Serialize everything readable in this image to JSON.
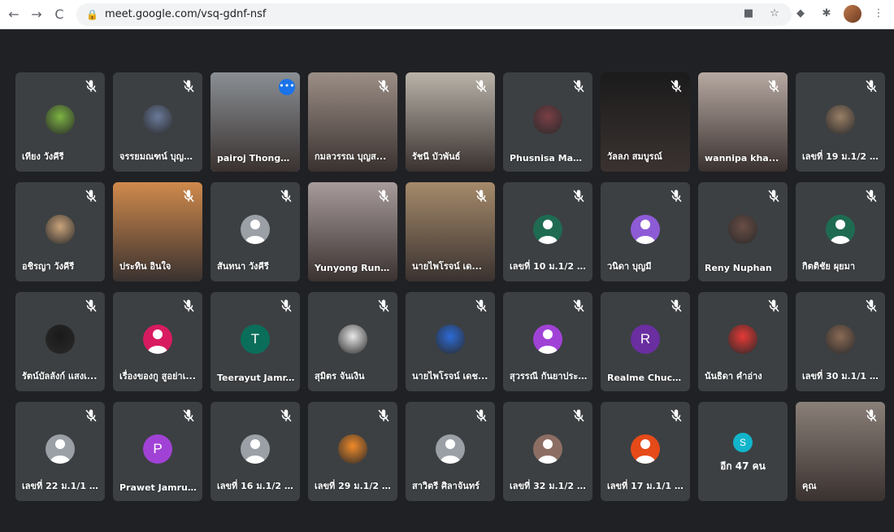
{
  "browser": {
    "url": "meet.google.com/vsq-gdnf-nsf",
    "back_glyph": "←",
    "forward_glyph": "→",
    "reload_glyph": "C",
    "lock_glyph": "🔒",
    "star_glyph": "☆",
    "menu_glyph": "⋮"
  },
  "more_people": {
    "initial": "S",
    "label": "อีก 47 คน"
  },
  "tiles": [
    {
      "name": "เทียง วังคีรี",
      "kind": "avatar",
      "color": "#7cb342",
      "initial": ""
    },
    {
      "name": "จรรยมณฑน์ บุญสิ...",
      "kind": "photo",
      "color": "#6a7a9a",
      "initial": ""
    },
    {
      "name": "pairoj Thongp...",
      "kind": "video",
      "color": "#8a8f94",
      "initial": "",
      "active": true
    },
    {
      "name": "กมลวรรณ บุญส...",
      "kind": "video",
      "color": "#9c8e86",
      "initial": ""
    },
    {
      "name": "รัชนี บัวพันธ์",
      "kind": "video",
      "color": "#b9b3a9",
      "initial": ""
    },
    {
      "name": "Phusnisa Makk...",
      "kind": "photo",
      "color": "#7a3f46",
      "initial": ""
    },
    {
      "name": "วัลลภ สมบูรณ์",
      "kind": "video",
      "color": "#1b1b1b",
      "initial": ""
    },
    {
      "name": "wannipa kha...",
      "kind": "video",
      "color": "#b7a9a2",
      "initial": ""
    },
    {
      "name": "เลขที่ 19 ม.1/2 เด็...",
      "kind": "photo",
      "color": "#9a7f66",
      "initial": ""
    },
    {
      "name": "อชิรญา วังคีรี",
      "kind": "photo",
      "color": "#caa37b",
      "initial": ""
    },
    {
      "name": "ประทิน อินใจ",
      "kind": "video",
      "color": "#d08a4c",
      "initial": ""
    },
    {
      "name": "สันทนา วังคีรี",
      "kind": "person",
      "color": "#9aa0a6",
      "initial": ""
    },
    {
      "name": "Yunyong Rung...",
      "kind": "video",
      "color": "#a79b9b",
      "initial": ""
    },
    {
      "name": "นายไพโรจน์ เด...",
      "kind": "video",
      "color": "#a58a6a",
      "initial": ""
    },
    {
      "name": "เลขที่ 10 ม.1/2 เด็...",
      "kind": "person",
      "color": "#1e6b52",
      "initial": ""
    },
    {
      "name": "วนิดา บุญมี",
      "kind": "person",
      "color": "#8e5bd6",
      "initial": ""
    },
    {
      "name": "Reny Nuphan",
      "kind": "photo",
      "color": "#6a4d45",
      "initial": ""
    },
    {
      "name": "กิตติชัย ผุยมา",
      "kind": "person",
      "color": "#1e6b52",
      "initial": ""
    },
    {
      "name": "รัตน์บัลลังก์ แสงเ...",
      "kind": "photo",
      "color": "#1a1a1a",
      "initial": ""
    },
    {
      "name": "เรื่องของกู สูอย่าเ...",
      "kind": "person",
      "color": "#d81b60",
      "initial": ""
    },
    {
      "name": "Teerayut Jamr...",
      "kind": "letter",
      "color": "#0b6e5a",
      "initial": "T"
    },
    {
      "name": "สุมิตร จันเงิน",
      "kind": "photo",
      "color": "#e8e8e8",
      "initial": ""
    },
    {
      "name": "นายไพโรจน์ เดช...",
      "kind": "photo",
      "color": "#2d6bd6",
      "initial": ""
    },
    {
      "name": "สุวรรณี กันยาประ...",
      "kind": "person",
      "color": "#a142d6",
      "initial": ""
    },
    {
      "name": "Realme Chuchai",
      "kind": "letter",
      "color": "#6a2ea0",
      "initial": "R"
    },
    {
      "name": "นันธิดา คำอ่าง",
      "kind": "photo",
      "color": "#e53935",
      "initial": ""
    },
    {
      "name": "เลขที่ 30 ม.1/1 เด็...",
      "kind": "photo",
      "color": "#8a6a55",
      "initial": ""
    },
    {
      "name": "เลขที่ 22 ม.1/1 เด็...",
      "kind": "person",
      "color": "#9aa0a6",
      "initial": ""
    },
    {
      "name": "Prawet Jamrun...",
      "kind": "letter",
      "color": "#a142d6",
      "initial": "P"
    },
    {
      "name": "เลขที่ 16 ม.1/2 เด็...",
      "kind": "person",
      "color": "#9aa0a6",
      "initial": ""
    },
    {
      "name": "เลขที่ 29 ม.1/2 เด็...",
      "kind": "photo",
      "color": "#f08a2a",
      "initial": ""
    },
    {
      "name": "สาวิตรี ศิลาจันทร์",
      "kind": "person",
      "color": "#9aa0a6",
      "initial": ""
    },
    {
      "name": "เลขที่ 32 ม.1/2 เด็...",
      "kind": "person",
      "color": "#8d6e63",
      "initial": ""
    },
    {
      "name": "เลขที่ 17 ม.1/1 เด็...",
      "kind": "person",
      "color": "#e64a19",
      "initial": ""
    },
    {
      "name": "",
      "kind": "more",
      "color": "#3c4043",
      "initial": ""
    },
    {
      "name": "คุณ",
      "kind": "video",
      "color": "#8a7f78",
      "initial": ""
    }
  ]
}
